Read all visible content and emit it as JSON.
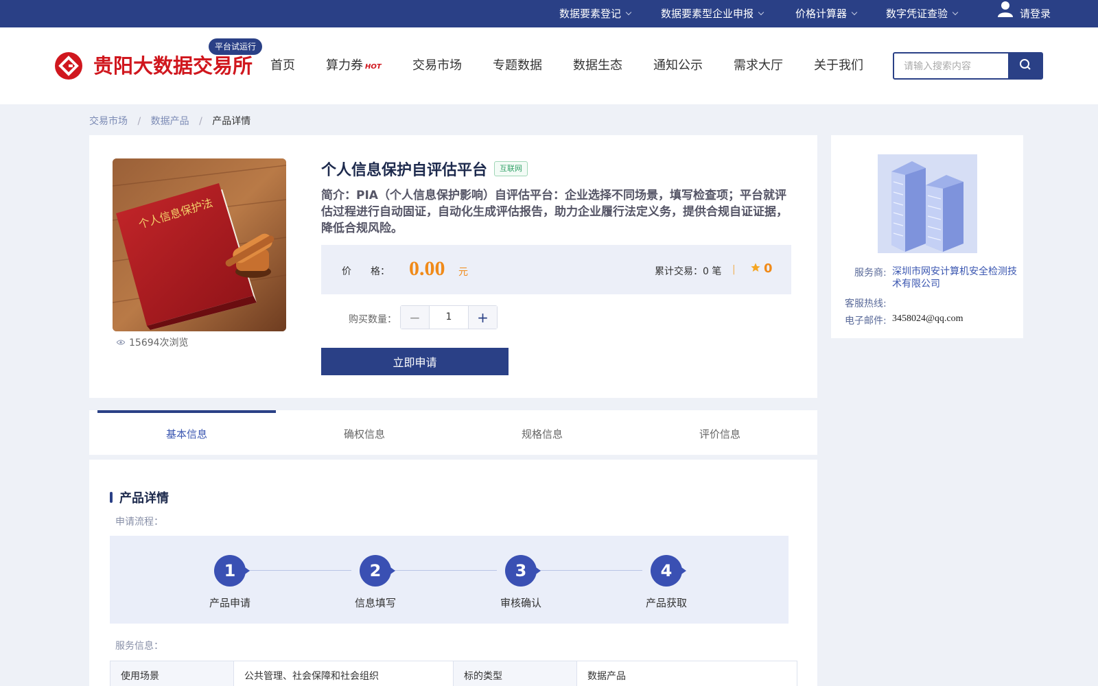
{
  "topbar": {
    "items": [
      "数据要素登记",
      "数据要素型企业申报",
      "价格计算器",
      "数字凭证查验"
    ],
    "login": "请登录"
  },
  "header": {
    "brand": "贵阳大数据交易所",
    "beta_badge": "平台试运行",
    "nav": [
      "首页",
      "算力券",
      "交易市场",
      "专题数据",
      "数据生态",
      "通知公示",
      "需求大厅",
      "关于我们"
    ],
    "hot_badge": "HOT",
    "search_placeholder": "请输入搜索内容"
  },
  "breadcrumb": [
    "交易市场",
    "数据产品",
    "产品详情"
  ],
  "product": {
    "title": "个人信息保护自评估平台",
    "tag": "互联网",
    "description": "简介：PIA（个人信息保护影响）自评估平台：企业选择不同场景，填写检查项；平台就评估过程进行自动固证，自动化生成评估报告，助力企业履行法定义务，提供合规自证证据，降低合规风险。",
    "image_text": "个人信息保护法",
    "views": "15694次浏览",
    "price_label": "价　　格：",
    "price": "0.00",
    "price_unit": "元",
    "trades": "累计交易：0 笔",
    "favorites": "0",
    "qty_label": "购买数量：",
    "qty_value": "1",
    "apply_label": "立即申请"
  },
  "provider": {
    "provider_label": "服务商:",
    "provider_value": "深圳市网安计算机安全检测技术有限公司",
    "provider_line1": "深圳市网安计算机安全检测技",
    "provider_line2": "术有限公司",
    "hotline_label": "客服热线:",
    "email_label": "电子邮件:",
    "email_value": "3458024@qq.com"
  },
  "tabs": [
    "基本信息",
    "确权信息",
    "规格信息",
    "评价信息"
  ],
  "details": {
    "section_title": "产品详情",
    "flow_label": "申请流程：",
    "steps": [
      {
        "num": "1",
        "label": "产品申请"
      },
      {
        "num": "2",
        "label": "信息填写"
      },
      {
        "num": "3",
        "label": "审核确认"
      },
      {
        "num": "4",
        "label": "产品获取"
      }
    ],
    "service_label": "服务信息：",
    "table": [
      "使用场景",
      "公共管理、社会保障和社会组织",
      "标的类型",
      "数据产品"
    ]
  },
  "colors": {
    "primary": "#2a4086",
    "brand_red": "#d0171e",
    "price_orange": "#f08a19",
    "tag_green": "#34a36a"
  }
}
